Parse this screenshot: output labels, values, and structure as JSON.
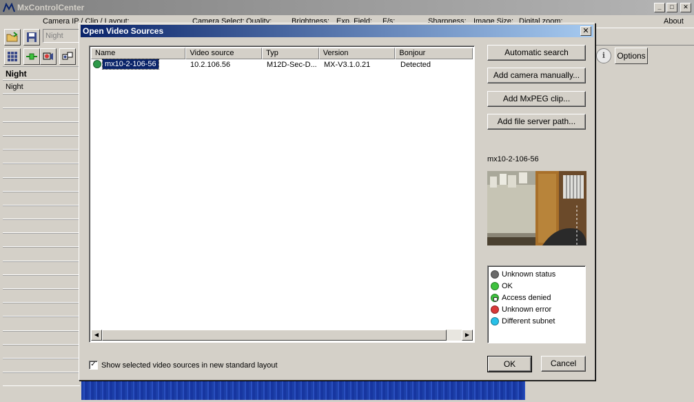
{
  "window": {
    "title": "MxControlCenter"
  },
  "menubar": {
    "camera_ip_label": "Camera IP / Clip / Layout:",
    "camera_select": "Camera Select:",
    "quality": "Quality:",
    "brightness": "Brightness:",
    "exp_field": "Exp. Field:",
    "fps": "F/s:",
    "sharpness": "Sharpness:",
    "image_size": "Image Size:",
    "digital_zoom": "Digital zoom:",
    "about": "About"
  },
  "toolbar": {
    "layout_value": "Night"
  },
  "sidebar": {
    "rows": [
      "Night",
      "Night"
    ]
  },
  "right_panel": {
    "info_glyph": "i",
    "options_label": "Options"
  },
  "dialog": {
    "title": "Open Video Sources",
    "close_glyph": "✕",
    "columns": [
      "Name",
      "Video source",
      "Typ",
      "Version",
      "Bonjour"
    ],
    "rows": [
      {
        "name": "mx10-2-106-56",
        "source": "10.2.106.56",
        "typ": "M12D-Sec-D...",
        "version": "MX-V3.1.0.21",
        "bonjour": "Detected",
        "status_color": "#2e9a4a"
      }
    ],
    "buttons": {
      "automatic_search": "Automatic search",
      "add_camera": "Add camera manually...",
      "add_mxpeg": "Add MxPEG clip...",
      "add_file_server": "Add file server path...",
      "ok": "OK",
      "cancel": "Cancel"
    },
    "camera_preview_name": "mx10-2-106-56",
    "legend": [
      {
        "label": "Unknown status",
        "color": "#6a6a6a",
        "icon": "gray-status-icon"
      },
      {
        "label": "OK",
        "color": "#3ec23e",
        "icon": "green-status-icon"
      },
      {
        "label": "Access denied",
        "color": "#3ec23e",
        "icon": "lock-status-icon"
      },
      {
        "label": "Unknown error",
        "color": "#d83838",
        "icon": "red-status-icon"
      },
      {
        "label": "Different subnet",
        "color": "#28c0e8",
        "icon": "cyan-status-icon"
      }
    ],
    "checkbox": {
      "label": "Show selected video sources in new standard layout",
      "checked": true
    }
  }
}
